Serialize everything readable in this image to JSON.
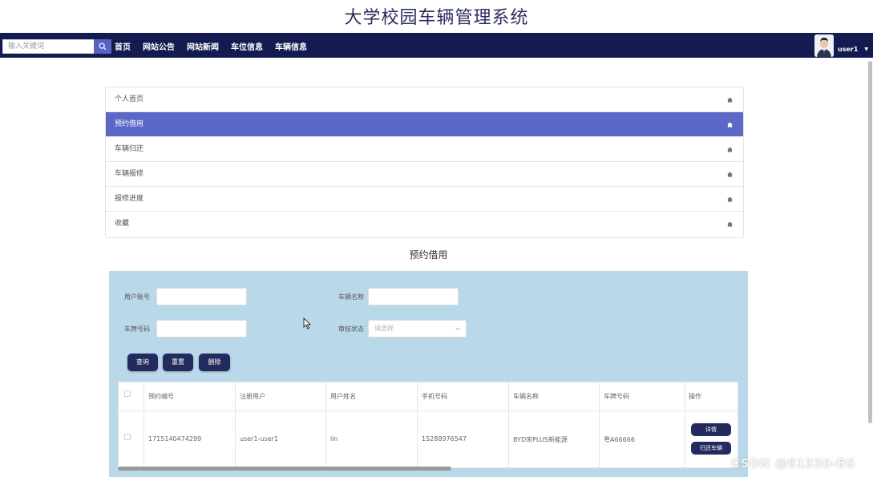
{
  "site": {
    "title": "大学校园车辆管理系统"
  },
  "navbar": {
    "search_placeholder": "输入关键词",
    "links": [
      "首页",
      "网站公告",
      "网站新闻",
      "车位信息",
      "车辆信息"
    ],
    "username": "user1"
  },
  "menu": {
    "items": [
      "个人首页",
      "预约借用",
      "车辆归还",
      "车辆报修",
      "报修进度",
      "收藏"
    ],
    "active_index": 1
  },
  "section": {
    "title": "预约借用"
  },
  "filters": {
    "user_account_label": "用户账号",
    "vehicle_name_label": "车辆名称",
    "plate_label": "车牌号码",
    "review_label": "审核状态",
    "review_placeholder": "请选择"
  },
  "actions": {
    "query": "查询",
    "reset": "重置",
    "delete": "删除"
  },
  "table": {
    "headers": [
      "预约编号",
      "注册用户",
      "用户姓名",
      "手机号码",
      "车辆名称",
      "车牌号码",
      "操作"
    ],
    "rows": [
      {
        "cells": [
          "1715140474299",
          "user1-user1",
          "lin",
          "15288976547",
          "BYD宋PLUS新能源",
          "粤A66666"
        ],
        "buttons": [
          "详情",
          "归还车辆"
        ]
      }
    ]
  },
  "watermark": "CSDN @81330-BS",
  "colors": {
    "navbar": "#141b50",
    "accent": "#5c68c7",
    "panel": "#b9d8ea",
    "button": "#232b5e"
  }
}
